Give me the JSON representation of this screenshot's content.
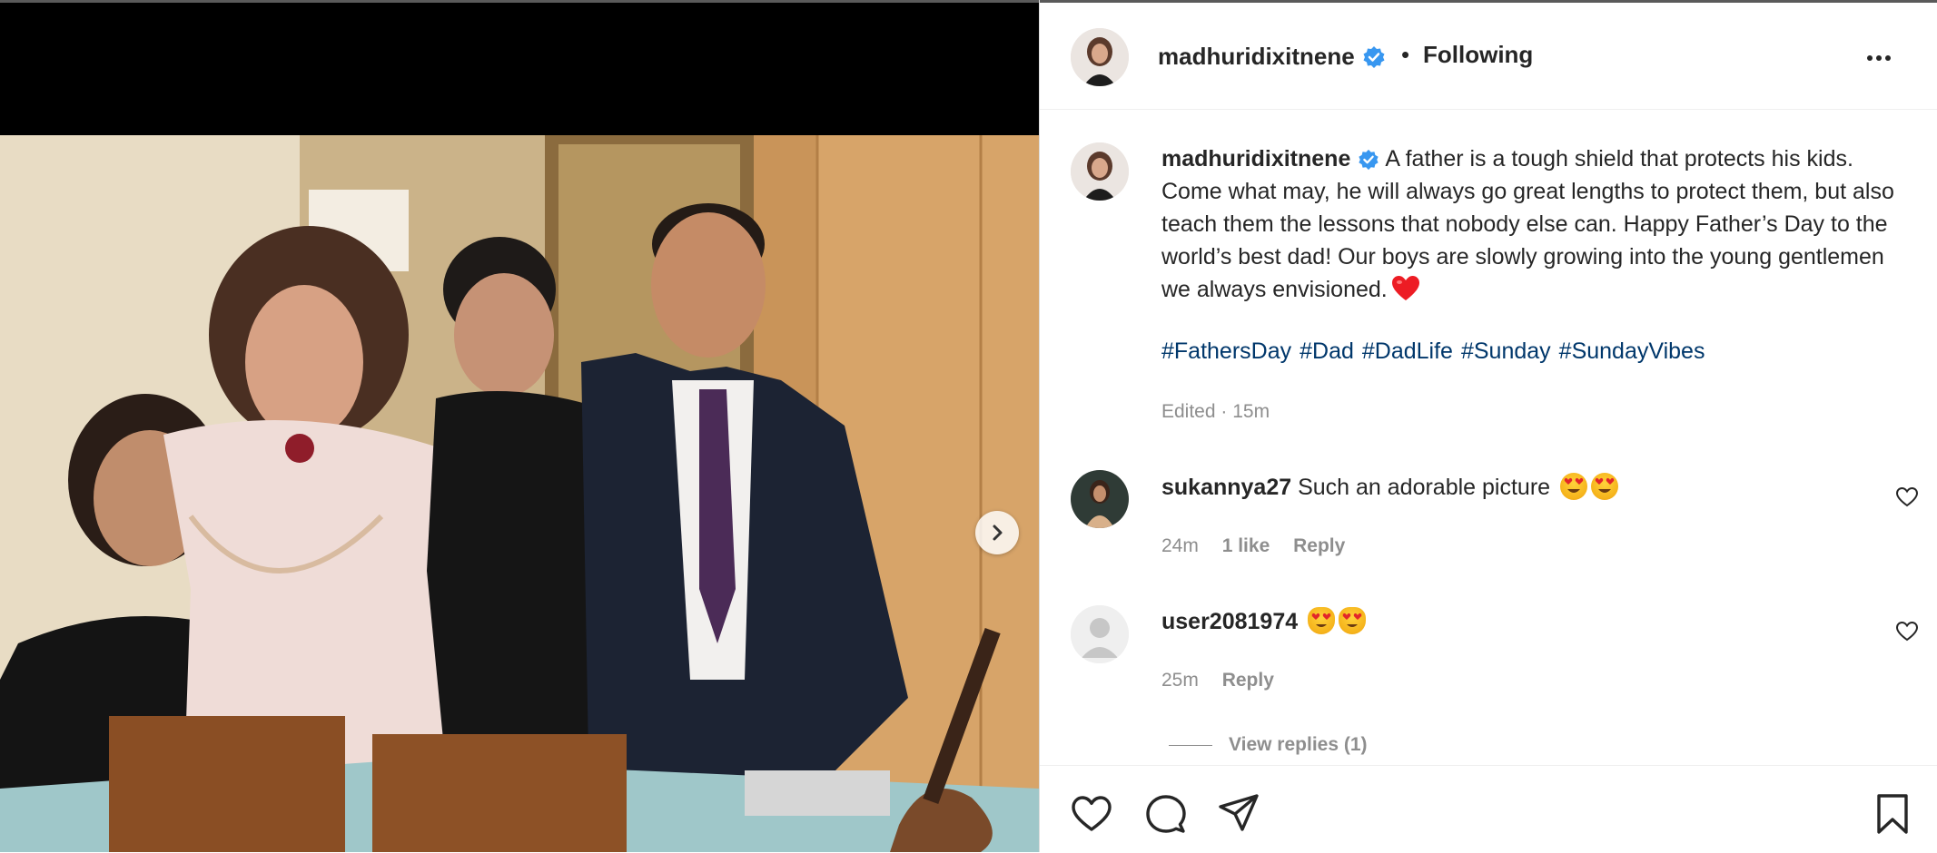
{
  "post": {
    "username": "madhuridixitnene",
    "separator": "•",
    "follow_status": "Following",
    "caption_user": "madhuridixitnene",
    "caption": "A father is a tough shield that protects his kids. Come what may, he will always go great lengths to protect them, but also teach them the lessons that nobody else can. Happy Father’s Day to the world’s best dad! Our boys are slowly growing into the young gentlemen we always envisioned.",
    "hashtags": [
      "#FathersDay",
      "#Dad",
      "#DadLife",
      "#Sunday",
      "#SundayVibes"
    ],
    "edited_time": "Edited · 15m"
  },
  "comments": [
    {
      "user": "sukannya27",
      "text": "Such an adorable picture",
      "time": "24m",
      "likes": "1 like",
      "reply": "Reply"
    },
    {
      "user": "user2081974",
      "text": "",
      "time": "25m",
      "reply": "Reply",
      "view_replies": "View replies (1)"
    }
  ],
  "icons": {
    "verified": "verified-badge-icon",
    "more": "more-options-icon",
    "next": "chevron-right-icon",
    "like": "heart-icon",
    "comment": "comment-icon",
    "share": "share-icon",
    "save": "bookmark-icon"
  },
  "colors": {
    "hashtag": "#00376b",
    "verified": "#3897f0",
    "heart_emoji": "#ed1c24",
    "muted": "#8e8e8e"
  }
}
